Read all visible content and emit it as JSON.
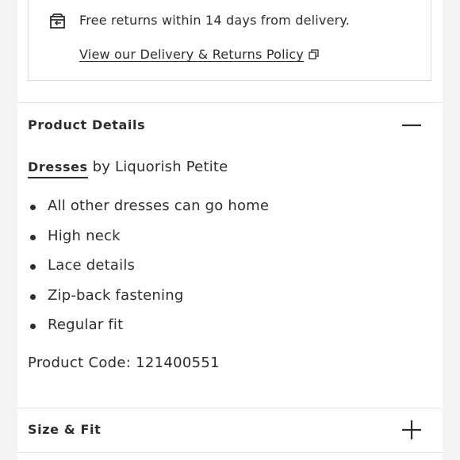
{
  "returns": {
    "text": "Free returns within 14 days from delivery.",
    "policy_link": "View our Delivery & Returns Policy",
    "icon": "returns-box-icon"
  },
  "product_details": {
    "title": "Product Details",
    "toggle_icon": "minus-icon",
    "expanded": true,
    "category_link": "Dresses",
    "by_text": " by Liquorish Petite",
    "features": [
      "All other dresses can go home",
      "High neck",
      "Lace details",
      "Zip-back fastening",
      "Regular fit"
    ],
    "product_code": "Product Code: 121400551"
  },
  "size_fit": {
    "title": "Size & Fit",
    "toggle_icon": "plus-icon",
    "expanded": false
  },
  "colors": {
    "text": "#2d2d2d",
    "background": "#ffffff",
    "page_background": "#f4f4f4",
    "divider": "#e2e2e2"
  }
}
